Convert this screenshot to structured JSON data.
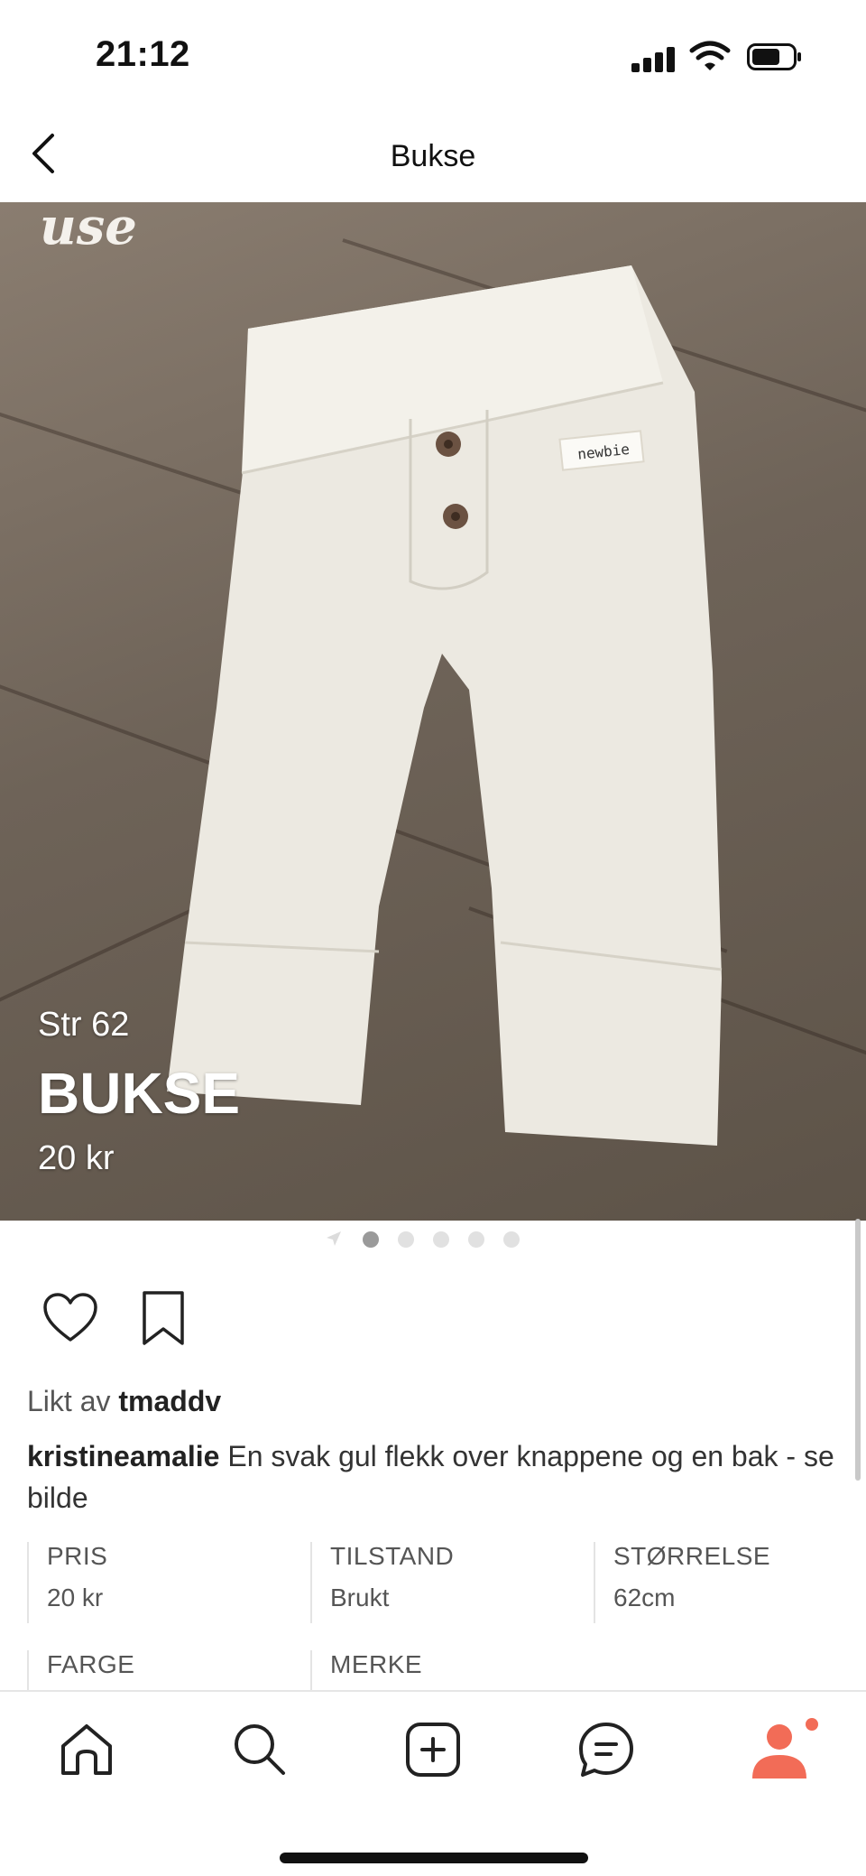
{
  "status_bar": {
    "time": "21:12"
  },
  "nav": {
    "title": "Bukse"
  },
  "hero": {
    "watermark": "use",
    "size_line": "Str 62",
    "title": "BUKSE",
    "price": "20 kr",
    "label_tag": "newbie"
  },
  "pager": {
    "count": 5,
    "active_index": 0
  },
  "actions": {
    "like": "heart-icon",
    "save": "bookmark-icon"
  },
  "liked_by": {
    "prefix": "Likt av",
    "user": "tmaddv"
  },
  "description": {
    "user": "kristineamalie",
    "text": "En svak gul flekk over knappene og en bak - se bilde"
  },
  "details": [
    {
      "label": "PRIS",
      "value": "20 kr"
    },
    {
      "label": "TILSTAND",
      "value": "Brukt"
    },
    {
      "label": "STØRRELSE",
      "value": "62cm"
    },
    {
      "label": "FARGE",
      "value": ""
    },
    {
      "label": "MERKE",
      "value": ""
    }
  ],
  "tabs": [
    "home-icon",
    "search-icon",
    "add-icon",
    "messages-icon",
    "profile-icon"
  ],
  "colors": {
    "accent": "#f26c57",
    "text": "#222222",
    "muted": "#555555"
  }
}
